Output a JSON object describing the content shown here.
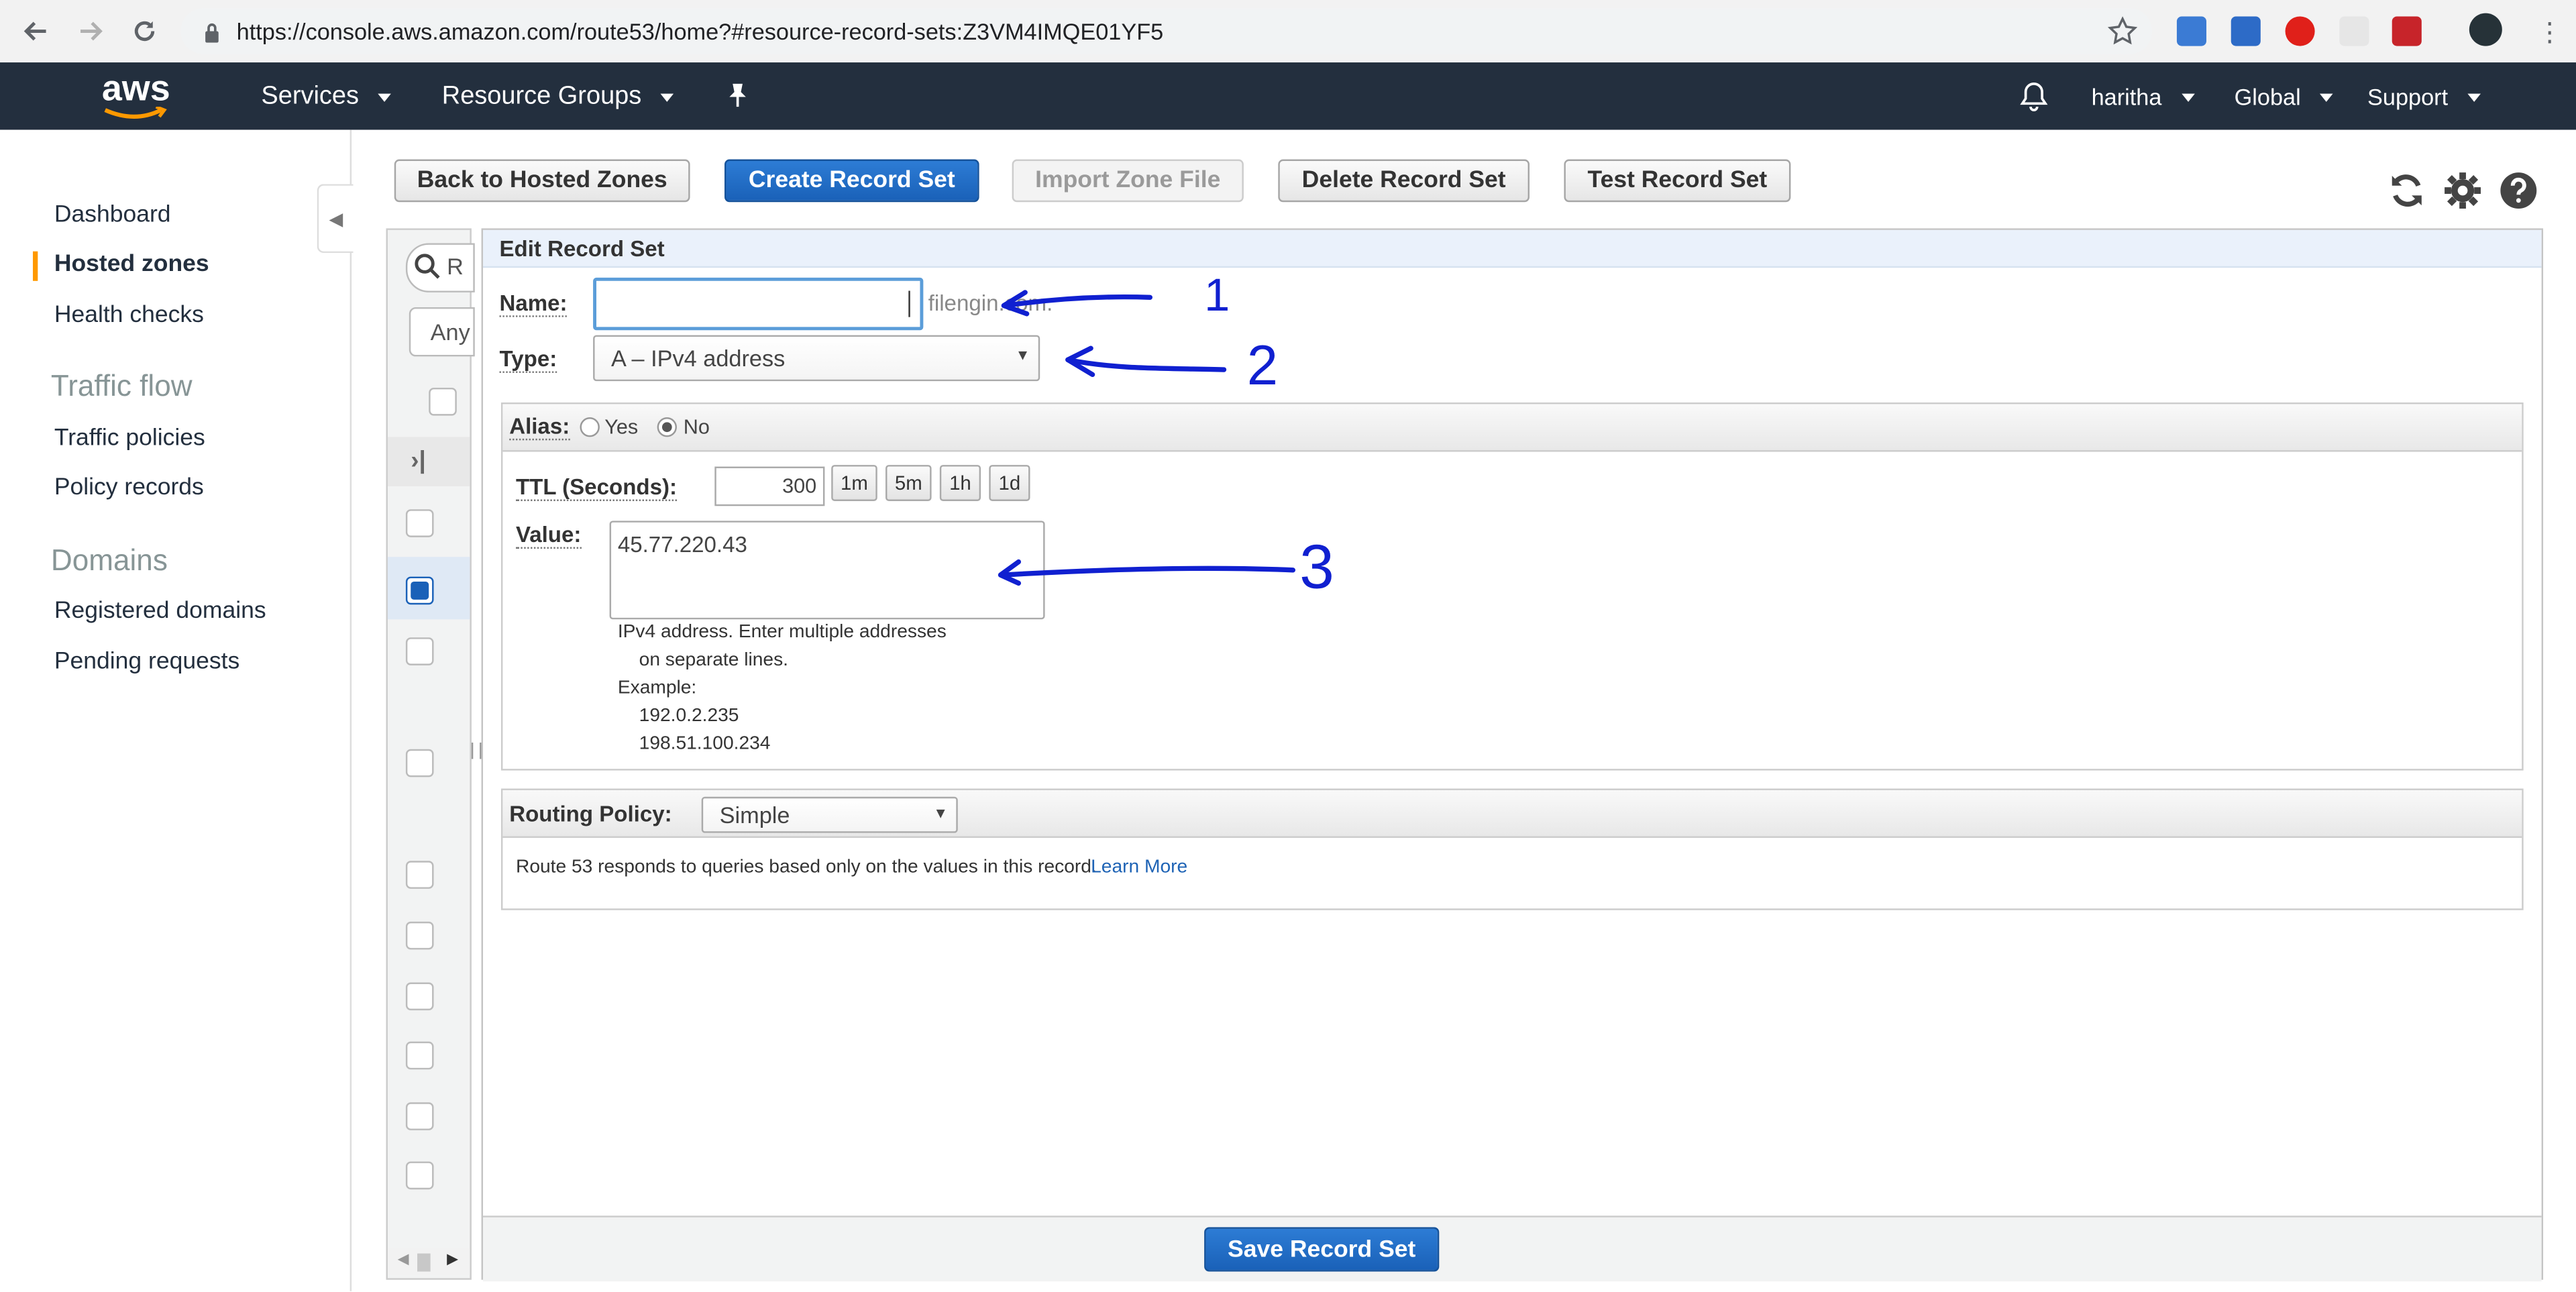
{
  "browser": {
    "url": "https://console.aws.amazon.com/route53/home?#resource-record-sets:Z3VM4IMQE01YF5"
  },
  "aws_nav": {
    "logo": "aws",
    "services": "Services",
    "resource_groups": "Resource Groups",
    "user": "haritha",
    "region": "Global",
    "support": "Support"
  },
  "sidebar": {
    "items": [
      {
        "label": "Dashboard"
      },
      {
        "label": "Hosted zones"
      },
      {
        "label": "Health checks"
      }
    ],
    "traffic_flow_heading": "Traffic flow",
    "traffic_items": [
      {
        "label": "Traffic policies"
      },
      {
        "label": "Policy records"
      }
    ],
    "domains_heading": "Domains",
    "domain_items": [
      {
        "label": "Registered domains"
      },
      {
        "label": "Pending requests"
      }
    ]
  },
  "toolbar": {
    "back": "Back to Hosted Zones",
    "create": "Create Record Set",
    "import": "Import Zone File",
    "delete": "Delete Record Set",
    "test": "Test Record Set"
  },
  "list": {
    "search_prefix": "R",
    "filter_value": "Any"
  },
  "edit": {
    "title": "Edit Record Set",
    "name_label": "Name:",
    "name_value": "",
    "domain_suffix": "filengin.com.",
    "type_label": "Type:",
    "type_value": "A – IPv4 address",
    "alias_label": "Alias:",
    "alias_yes": "Yes",
    "alias_no": "No",
    "alias_selected": "No",
    "ttl_label": "TTL (Seconds):",
    "ttl_value": "300",
    "ttl_buttons": [
      "1m",
      "5m",
      "1h",
      "1d"
    ],
    "value_label": "Value:",
    "value_text": "45.77.220.43",
    "help_lines": [
      "IPv4 address. Enter multiple addresses",
      "on separate lines.",
      "Example:",
      "192.0.2.235",
      "198.51.100.234"
    ],
    "routing_label": "Routing Policy:",
    "routing_value": "Simple",
    "routing_note": "Route 53 responds to queries based only on the values in this record.",
    "learn_more": "Learn More",
    "save": "Save Record Set"
  },
  "annotations": [
    "1",
    "2",
    "3"
  ],
  "colors": {
    "aws_nav_bg": "#232f3e",
    "primary_button": "#1a61b8",
    "active_accent": "#ff9900",
    "annotation_ink": "#1020d0"
  }
}
